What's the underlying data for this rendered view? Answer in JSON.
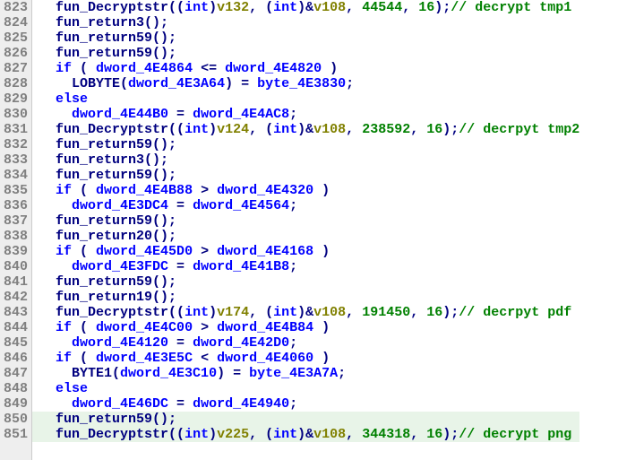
{
  "lines": [
    {
      "num": "823",
      "hl": false,
      "tokens": [
        {
          "t": "call",
          "v": "  fun_Decryptstr"
        },
        {
          "t": "punct",
          "v": "(("
        },
        {
          "t": "cast",
          "v": "int"
        },
        {
          "t": "punct",
          "v": ")"
        },
        {
          "t": "var",
          "v": "v132"
        },
        {
          "t": "punct",
          "v": ", ("
        },
        {
          "t": "cast",
          "v": "int"
        },
        {
          "t": "punct",
          "v": ")&"
        },
        {
          "t": "var",
          "v": "v108"
        },
        {
          "t": "punct",
          "v": ", "
        },
        {
          "t": "number",
          "v": "44544"
        },
        {
          "t": "punct",
          "v": ", "
        },
        {
          "t": "number",
          "v": "16"
        },
        {
          "t": "punct",
          "v": ");"
        },
        {
          "t": "comment",
          "v": "// decrypt tmp1"
        }
      ]
    },
    {
      "num": "824",
      "hl": false,
      "tokens": [
        {
          "t": "call",
          "v": "  fun_return3"
        },
        {
          "t": "punct",
          "v": "();"
        }
      ]
    },
    {
      "num": "825",
      "hl": false,
      "tokens": [
        {
          "t": "call",
          "v": "  fun_return59"
        },
        {
          "t": "punct",
          "v": "();"
        }
      ]
    },
    {
      "num": "826",
      "hl": false,
      "tokens": [
        {
          "t": "call",
          "v": "  fun_return59"
        },
        {
          "t": "punct",
          "v": "();"
        }
      ]
    },
    {
      "num": "827",
      "hl": false,
      "tokens": [
        {
          "t": "keyword",
          "v": "  if"
        },
        {
          "t": "punct",
          "v": " ( "
        },
        {
          "t": "ident",
          "v": "dword_4E4864"
        },
        {
          "t": "punct",
          "v": " <= "
        },
        {
          "t": "ident",
          "v": "dword_4E4820"
        },
        {
          "t": "punct",
          "v": " )"
        }
      ]
    },
    {
      "num": "828",
      "hl": false,
      "tokens": [
        {
          "t": "call",
          "v": "    LOBYTE"
        },
        {
          "t": "punct",
          "v": "("
        },
        {
          "t": "ident",
          "v": "dword_4E3A64"
        },
        {
          "t": "punct",
          "v": ") = "
        },
        {
          "t": "ident",
          "v": "byte_4E3830"
        },
        {
          "t": "punct",
          "v": ";"
        }
      ]
    },
    {
      "num": "829",
      "hl": false,
      "tokens": [
        {
          "t": "keyword",
          "v": "  else"
        }
      ]
    },
    {
      "num": "830",
      "hl": false,
      "tokens": [
        {
          "t": "ident",
          "v": "    dword_4E44B0"
        },
        {
          "t": "punct",
          "v": " = "
        },
        {
          "t": "ident",
          "v": "dword_4E4AC8"
        },
        {
          "t": "punct",
          "v": ";"
        }
      ]
    },
    {
      "num": "831",
      "hl": false,
      "tokens": [
        {
          "t": "call",
          "v": "  fun_Decryptstr"
        },
        {
          "t": "punct",
          "v": "(("
        },
        {
          "t": "cast",
          "v": "int"
        },
        {
          "t": "punct",
          "v": ")"
        },
        {
          "t": "var",
          "v": "v124"
        },
        {
          "t": "punct",
          "v": ", ("
        },
        {
          "t": "cast",
          "v": "int"
        },
        {
          "t": "punct",
          "v": ")&"
        },
        {
          "t": "var",
          "v": "v108"
        },
        {
          "t": "punct",
          "v": ", "
        },
        {
          "t": "number",
          "v": "238592"
        },
        {
          "t": "punct",
          "v": ", "
        },
        {
          "t": "number",
          "v": "16"
        },
        {
          "t": "punct",
          "v": ");"
        },
        {
          "t": "comment",
          "v": "// decrpyt tmp2"
        }
      ]
    },
    {
      "num": "832",
      "hl": false,
      "tokens": [
        {
          "t": "call",
          "v": "  fun_return59"
        },
        {
          "t": "punct",
          "v": "();"
        }
      ]
    },
    {
      "num": "833",
      "hl": false,
      "tokens": [
        {
          "t": "call",
          "v": "  fun_return3"
        },
        {
          "t": "punct",
          "v": "();"
        }
      ]
    },
    {
      "num": "834",
      "hl": false,
      "tokens": [
        {
          "t": "call",
          "v": "  fun_return59"
        },
        {
          "t": "punct",
          "v": "();"
        }
      ]
    },
    {
      "num": "835",
      "hl": false,
      "tokens": [
        {
          "t": "keyword",
          "v": "  if"
        },
        {
          "t": "punct",
          "v": " ( "
        },
        {
          "t": "ident",
          "v": "dword_4E4B88"
        },
        {
          "t": "punct",
          "v": " > "
        },
        {
          "t": "ident",
          "v": "dword_4E4320"
        },
        {
          "t": "punct",
          "v": " )"
        }
      ]
    },
    {
      "num": "836",
      "hl": false,
      "tokens": [
        {
          "t": "ident",
          "v": "    dword_4E3DC4"
        },
        {
          "t": "punct",
          "v": " = "
        },
        {
          "t": "ident",
          "v": "dword_4E4564"
        },
        {
          "t": "punct",
          "v": ";"
        }
      ]
    },
    {
      "num": "837",
      "hl": false,
      "tokens": [
        {
          "t": "call",
          "v": "  fun_return59"
        },
        {
          "t": "punct",
          "v": "();"
        }
      ]
    },
    {
      "num": "838",
      "hl": false,
      "tokens": [
        {
          "t": "call",
          "v": "  fun_return20"
        },
        {
          "t": "punct",
          "v": "();"
        }
      ]
    },
    {
      "num": "839",
      "hl": false,
      "tokens": [
        {
          "t": "keyword",
          "v": "  if"
        },
        {
          "t": "punct",
          "v": " ( "
        },
        {
          "t": "ident",
          "v": "dword_4E45D0"
        },
        {
          "t": "punct",
          "v": " > "
        },
        {
          "t": "ident",
          "v": "dword_4E4168"
        },
        {
          "t": "punct",
          "v": " )"
        }
      ]
    },
    {
      "num": "840",
      "hl": false,
      "tokens": [
        {
          "t": "ident",
          "v": "    dword_4E3FDC"
        },
        {
          "t": "punct",
          "v": " = "
        },
        {
          "t": "ident",
          "v": "dword_4E41B8"
        },
        {
          "t": "punct",
          "v": ";"
        }
      ]
    },
    {
      "num": "841",
      "hl": false,
      "tokens": [
        {
          "t": "call",
          "v": "  fun_return59"
        },
        {
          "t": "punct",
          "v": "();"
        }
      ]
    },
    {
      "num": "842",
      "hl": false,
      "tokens": [
        {
          "t": "call",
          "v": "  fun_return19"
        },
        {
          "t": "punct",
          "v": "();"
        }
      ]
    },
    {
      "num": "843",
      "hl": false,
      "tokens": [
        {
          "t": "call",
          "v": "  fun_Decryptstr"
        },
        {
          "t": "punct",
          "v": "(("
        },
        {
          "t": "cast",
          "v": "int"
        },
        {
          "t": "punct",
          "v": ")"
        },
        {
          "t": "var",
          "v": "v174"
        },
        {
          "t": "punct",
          "v": ", ("
        },
        {
          "t": "cast",
          "v": "int"
        },
        {
          "t": "punct",
          "v": ")&"
        },
        {
          "t": "var",
          "v": "v108"
        },
        {
          "t": "punct",
          "v": ", "
        },
        {
          "t": "number",
          "v": "191450"
        },
        {
          "t": "punct",
          "v": ", "
        },
        {
          "t": "number",
          "v": "16"
        },
        {
          "t": "punct",
          "v": ");"
        },
        {
          "t": "comment",
          "v": "// decrpyt pdf"
        }
      ]
    },
    {
      "num": "844",
      "hl": false,
      "tokens": [
        {
          "t": "keyword",
          "v": "  if"
        },
        {
          "t": "punct",
          "v": " ( "
        },
        {
          "t": "ident",
          "v": "dword_4E4C00"
        },
        {
          "t": "punct",
          "v": " > "
        },
        {
          "t": "ident",
          "v": "dword_4E4B84"
        },
        {
          "t": "punct",
          "v": " )"
        }
      ]
    },
    {
      "num": "845",
      "hl": false,
      "tokens": [
        {
          "t": "ident",
          "v": "    dword_4E4120"
        },
        {
          "t": "punct",
          "v": " = "
        },
        {
          "t": "ident",
          "v": "dword_4E42D0"
        },
        {
          "t": "punct",
          "v": ";"
        }
      ]
    },
    {
      "num": "846",
      "hl": false,
      "tokens": [
        {
          "t": "keyword",
          "v": "  if"
        },
        {
          "t": "punct",
          "v": " ( "
        },
        {
          "t": "ident",
          "v": "dword_4E3E5C"
        },
        {
          "t": "punct",
          "v": " < "
        },
        {
          "t": "ident",
          "v": "dword_4E4060"
        },
        {
          "t": "punct",
          "v": " )"
        }
      ]
    },
    {
      "num": "847",
      "hl": false,
      "tokens": [
        {
          "t": "call",
          "v": "    BYTE1"
        },
        {
          "t": "punct",
          "v": "("
        },
        {
          "t": "ident",
          "v": "dword_4E3C10"
        },
        {
          "t": "punct",
          "v": ") = "
        },
        {
          "t": "ident",
          "v": "byte_4E3A7A"
        },
        {
          "t": "punct",
          "v": ";"
        }
      ]
    },
    {
      "num": "848",
      "hl": false,
      "tokens": [
        {
          "t": "keyword",
          "v": "  else"
        }
      ]
    },
    {
      "num": "849",
      "hl": false,
      "tokens": [
        {
          "t": "ident",
          "v": "    dword_4E46DC"
        },
        {
          "t": "punct",
          "v": " = "
        },
        {
          "t": "ident",
          "v": "dword_4E4940"
        },
        {
          "t": "punct",
          "v": ";"
        }
      ]
    },
    {
      "num": "850",
      "hl": true,
      "tokens": [
        {
          "t": "call",
          "v": "  fun_return59"
        },
        {
          "t": "punct",
          "v": "();"
        }
      ]
    },
    {
      "num": "851",
      "hl": true,
      "tokens": [
        {
          "t": "call",
          "v": "  fun_Decryptstr"
        },
        {
          "t": "punct",
          "v": "(("
        },
        {
          "t": "cast",
          "v": "int"
        },
        {
          "t": "punct",
          "v": ")"
        },
        {
          "t": "var",
          "v": "v225"
        },
        {
          "t": "punct",
          "v": ", ("
        },
        {
          "t": "cast",
          "v": "int"
        },
        {
          "t": "punct",
          "v": ")&"
        },
        {
          "t": "var",
          "v": "v108"
        },
        {
          "t": "punct",
          "v": ", "
        },
        {
          "t": "number",
          "v": "344318"
        },
        {
          "t": "punct",
          "v": ", "
        },
        {
          "t": "number",
          "v": "16"
        },
        {
          "t": "punct",
          "v": ");"
        },
        {
          "t": "comment",
          "v": "// decrypt png"
        }
      ]
    }
  ]
}
